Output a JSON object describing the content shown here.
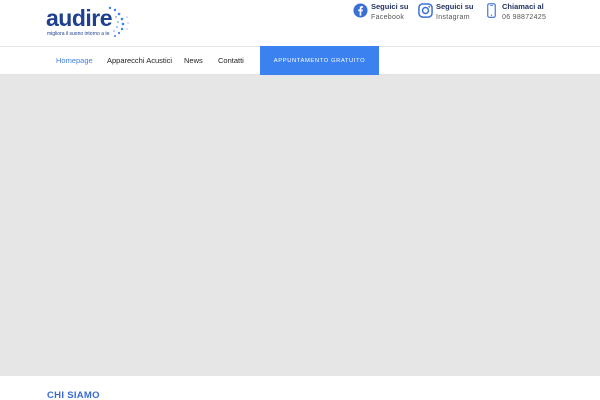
{
  "logo": {
    "word": "audire",
    "tagline": "migliora il suono intorno a te"
  },
  "contacts": [
    {
      "icon": "facebook-icon",
      "line1": "Seguici su",
      "line2": "Facebook"
    },
    {
      "icon": "instagram-icon",
      "line1": "Seguici su",
      "line2": "Instagram"
    },
    {
      "icon": "phone-icon",
      "line1": "Chiamaci al",
      "line2": "06 98872425"
    }
  ],
  "nav": {
    "items": [
      "Homepage",
      "Apparecchi Acustici",
      "News",
      "Contatti"
    ],
    "active": "Homepage",
    "cta": "APPUNTAMENTO GRATUITO"
  },
  "section": {
    "title": "CHI SIAMO"
  },
  "colors": {
    "brand": "#1f3f8f",
    "accent": "#3b82f0",
    "hero_bg": "#e6e6e6"
  }
}
